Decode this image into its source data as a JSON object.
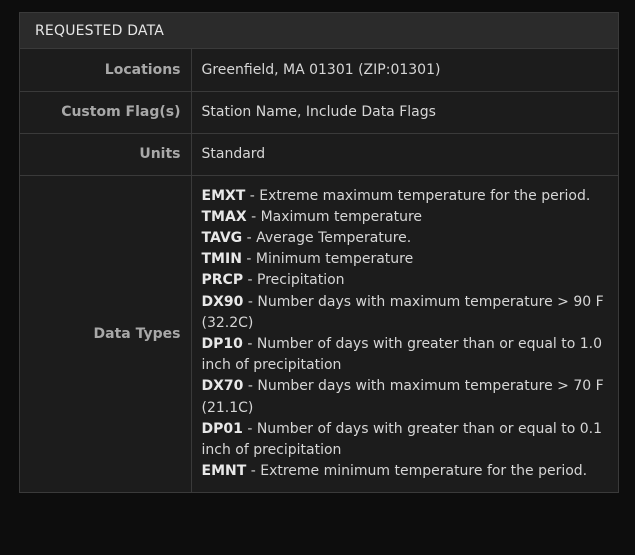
{
  "panel": {
    "title": "REQUESTED DATA"
  },
  "rows": [
    {
      "label": "Locations",
      "value": "Greenfield, MA 01301 (ZIP:01301)"
    },
    {
      "label": "Custom Flag(s)",
      "value": "Station Name, Include Data Flags"
    },
    {
      "label": "Units",
      "value": "Standard"
    }
  ],
  "data_types": {
    "label": "Data Types",
    "items": [
      {
        "code": "EMXT",
        "desc": " - Extreme maximum temperature for the period."
      },
      {
        "code": "TMAX",
        "desc": " - Maximum temperature"
      },
      {
        "code": "TAVG",
        "desc": " - Average Temperature."
      },
      {
        "code": "TMIN",
        "desc": " - Minimum temperature"
      },
      {
        "code": "PRCP",
        "desc": " - Precipitation"
      },
      {
        "code": "DX90",
        "desc": " - Number days with maximum temperature > 90 F (32.2C)"
      },
      {
        "code": "DP10",
        "desc": " - Number of days with greater than or equal to 1.0 inch of precipitation"
      },
      {
        "code": "DX70",
        "desc": " - Number days with maximum temperature > 70 F (21.1C)"
      },
      {
        "code": "DP01",
        "desc": " - Number of days with greater than or equal to 0.1 inch of precipitation"
      },
      {
        "code": "EMNT",
        "desc": " - Extreme minimum temperature for the period."
      }
    ]
  }
}
